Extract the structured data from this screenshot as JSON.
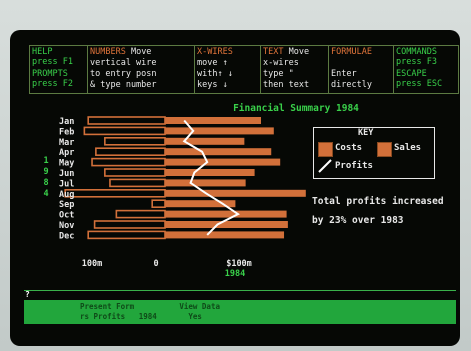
{
  "menu": {
    "help": {
      "key_label": "HELP",
      "key_hint": "press F1"
    },
    "prompts": {
      "key_label": "PROMPTS",
      "key_hint": "press F2"
    },
    "numbers": {
      "title": "NUMBERS",
      "line1": "Move",
      "line2": "vertical wire",
      "line3": "to entry posn",
      "line4": "& type number"
    },
    "xwires": {
      "title": "X-WIRES",
      "line1": "move ↑",
      "line2": "with↑ ↓",
      "line3": "keys ↓"
    },
    "text": {
      "title": "TEXT",
      "line1": "Move",
      "line2": "x-wires",
      "line3": "type \"",
      "line4": "then text"
    },
    "formulae": {
      "title": "FORMULAE",
      "line1": "Enter",
      "line2": "directly"
    },
    "commands": {
      "title": "COMMANDS",
      "line1": "press F3"
    },
    "escape": {
      "title": "ESCAPE",
      "line1": "press ESC"
    }
  },
  "chart_data": {
    "type": "bar",
    "title": "Financial Summary 1984",
    "year_label_vertical": "1984",
    "categories": [
      "Jan",
      "Feb",
      "Mar",
      "Apr",
      "May",
      "Jun",
      "Jul",
      "Aug",
      "Sep",
      "Oct",
      "Nov",
      "Dec"
    ],
    "series": [
      {
        "name": "Costs",
        "values": [
          -60,
          -63,
          -47,
          -54,
          -57,
          -47,
          -43,
          -78,
          -10,
          -38,
          -55,
          -60
        ]
      },
      {
        "name": "Sales",
        "values": [
          75,
          85,
          62,
          83,
          90,
          70,
          63,
          110,
          55,
          95,
          96,
          93
        ]
      },
      {
        "name": "Profits",
        "values": [
          15,
          22,
          15,
          29,
          33,
          23,
          20,
          32,
          45,
          57,
          41,
          33
        ]
      }
    ],
    "x_ticks": [
      "100m",
      "0",
      "$100m"
    ],
    "x_axis_year": "1984",
    "xlim": [
      -100,
      120
    ],
    "colors": {
      "bars": "#d2703a",
      "profits": "#ffffff",
      "text": "#e8e8e8",
      "title": "#39d04a"
    }
  },
  "key": {
    "title": "KEY",
    "costs": "Costs",
    "sales": "Sales",
    "profits": "Profits"
  },
  "note": {
    "line1": "Total profits increased",
    "line2": "by 23% over 1983"
  },
  "prompt_symbol": "?",
  "status": {
    "line1": "Present Form          View Data",
    "line2": "rs Profits   1984       Yes"
  }
}
